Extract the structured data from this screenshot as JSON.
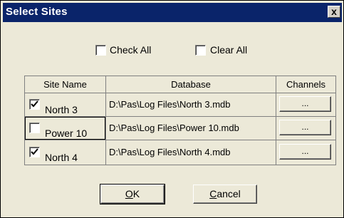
{
  "window": {
    "title": "Select Sites",
    "close_glyph": "x",
    "titlebar_color": "#0a246a",
    "face_color": "#ece9d8"
  },
  "toolbar": {
    "check_all": {
      "label": "Check All",
      "checked": false
    },
    "clear_all": {
      "label": "Clear All",
      "checked": false
    }
  },
  "grid": {
    "headers": [
      "Site Name",
      "Database",
      "Channels"
    ],
    "rows": [
      {
        "site": "North 3",
        "checked": true,
        "db": "D:\\Pas\\Log Files\\North 3.mdb",
        "channels": "..."
      },
      {
        "site": "Power 10",
        "checked": false,
        "db": "D:\\Pas\\Log Files\\Power 10.mdb",
        "channels": "..."
      },
      {
        "site": "North 4",
        "checked": true,
        "db": "D:\\Pas\\Log Files\\North 4.mdb",
        "channels": "..."
      }
    ]
  },
  "buttons": {
    "ok": {
      "prefix": "",
      "mnemonic": "O",
      "rest": "K"
    },
    "cancel": {
      "prefix": "",
      "mnemonic": "C",
      "rest": "ancel"
    }
  }
}
